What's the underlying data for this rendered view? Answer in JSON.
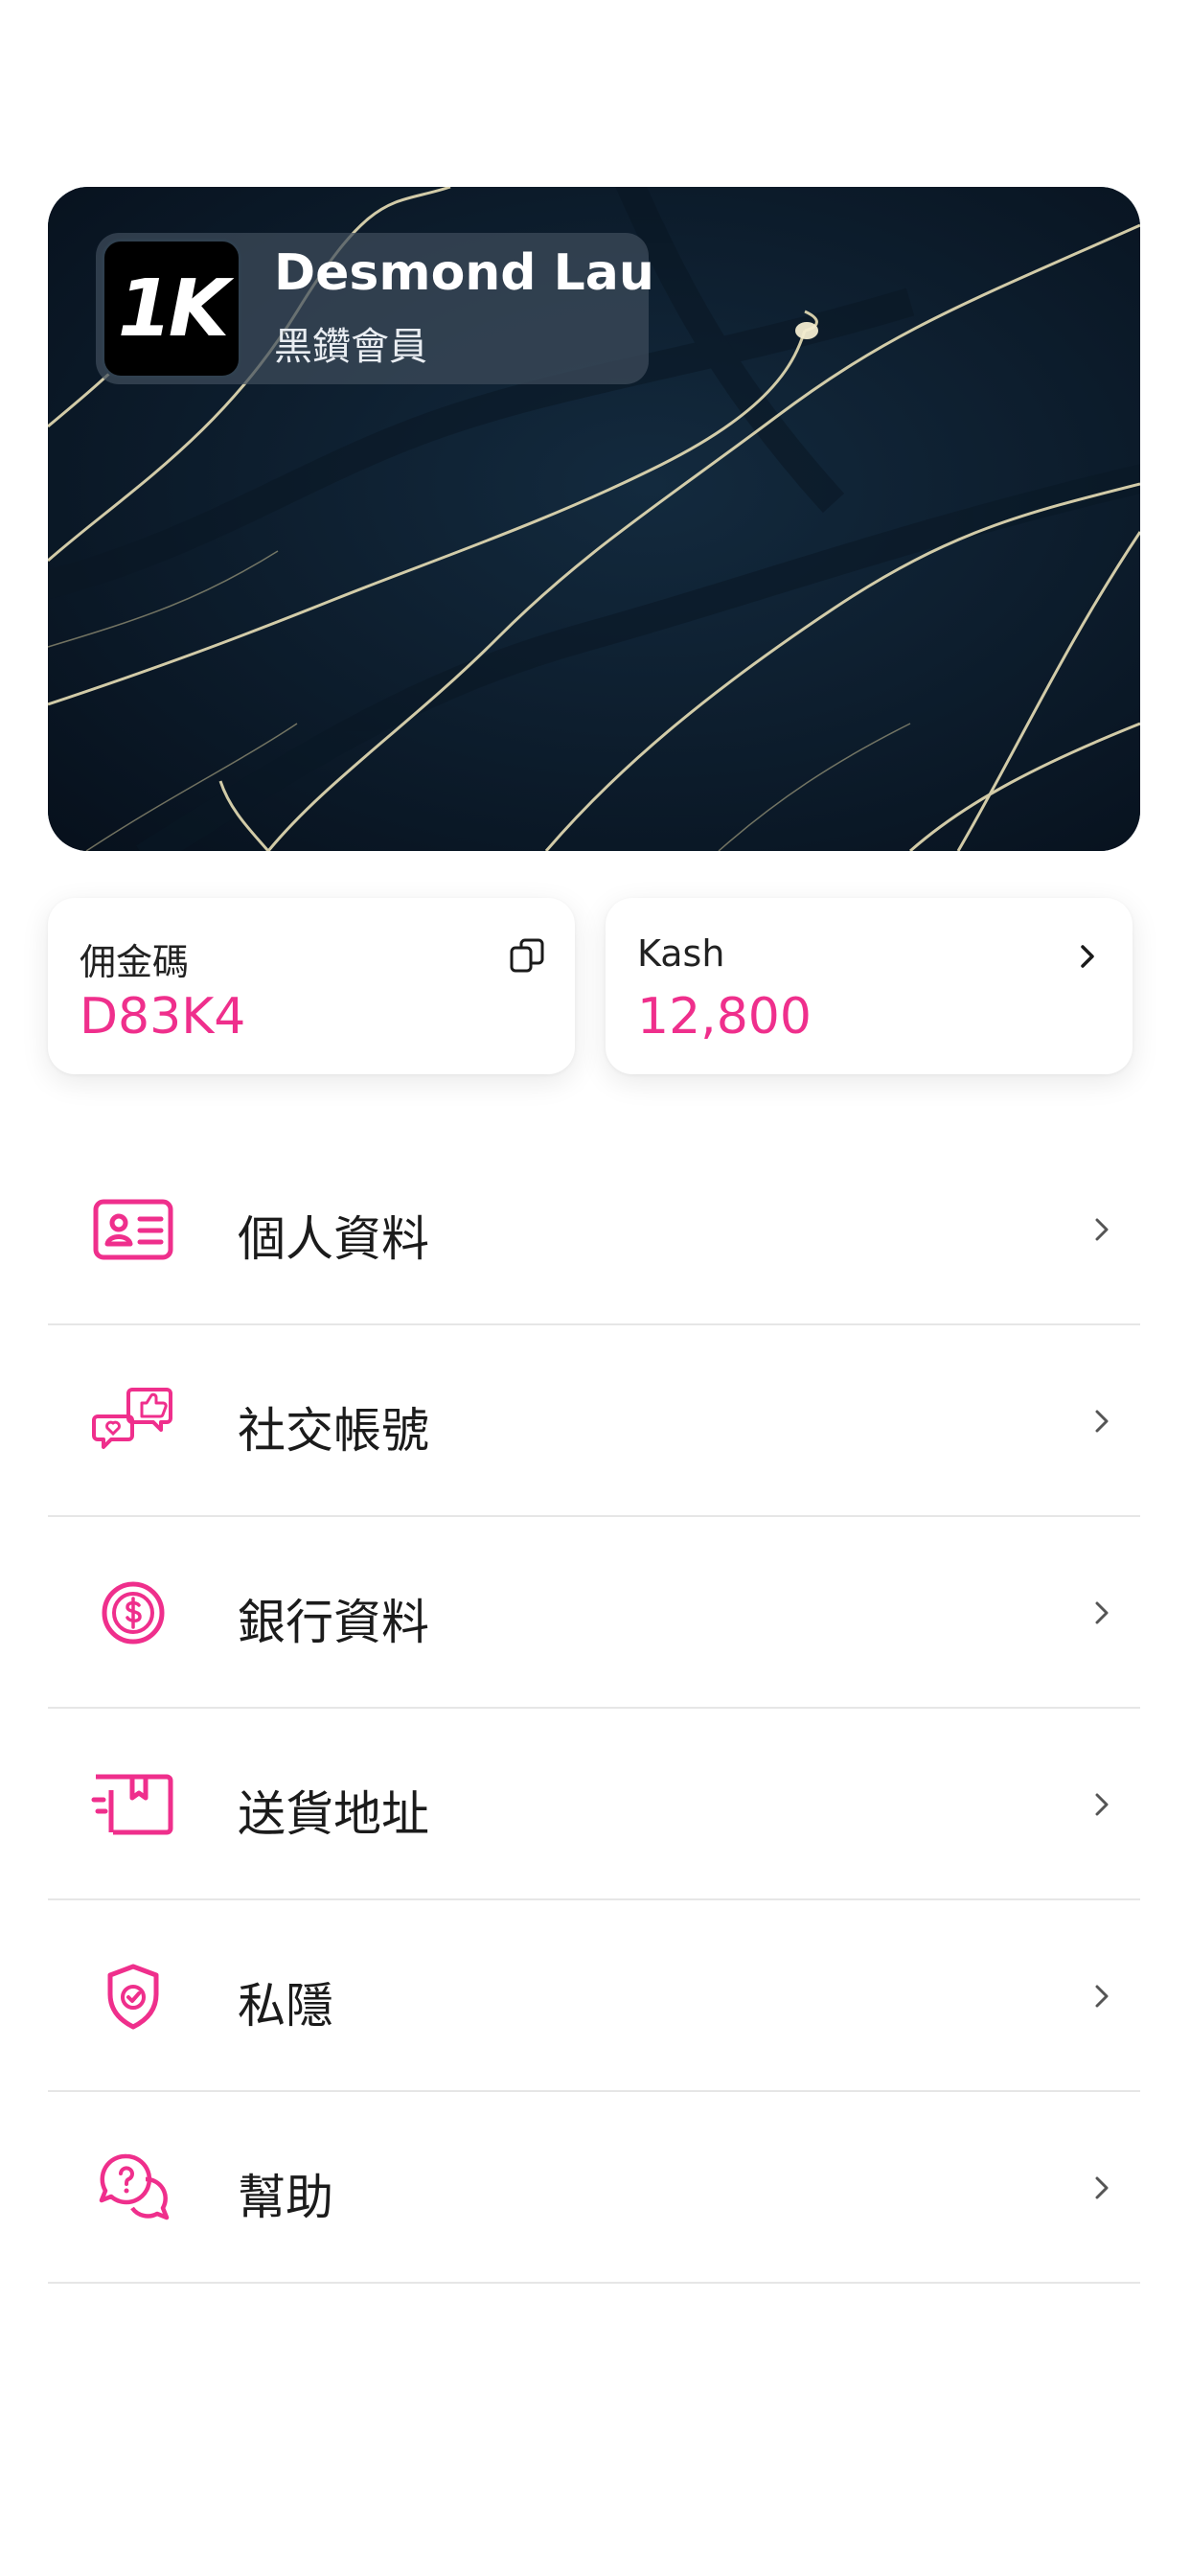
{
  "member_card": {
    "logo_text": "1K",
    "name": "Desmond Lau",
    "tier": "黑鑽會員"
  },
  "referral_tile": {
    "label": "佣金碼",
    "value": "D83K4",
    "icon": "copy-icon"
  },
  "kash_tile": {
    "label": "Kash",
    "value": "12,800",
    "icon": "chevron-right-icon"
  },
  "menu": {
    "items": [
      {
        "label": "個人資料",
        "icon": "id-card-icon"
      },
      {
        "label": "社交帳號",
        "icon": "social-chat-icon"
      },
      {
        "label": "銀行資料",
        "icon": "dollar-coin-icon"
      },
      {
        "label": "送貨地址",
        "icon": "delivery-box-icon"
      },
      {
        "label": "私隱",
        "icon": "shield-check-icon"
      },
      {
        "label": "幫助",
        "icon": "help-chat-icon"
      }
    ]
  },
  "colors": {
    "accent": "#ef2f8c",
    "card_background": "#0c1c2c",
    "divider": "#e6e6e6"
  }
}
